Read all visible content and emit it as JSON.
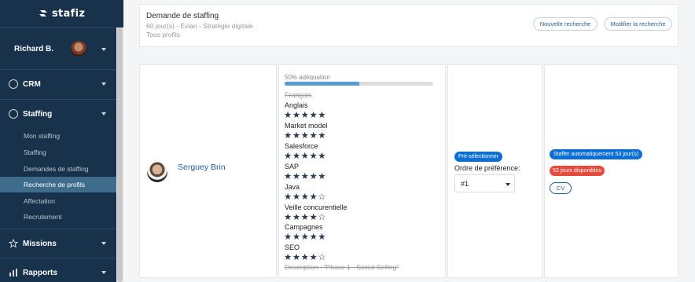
{
  "sidebar": {
    "logo_text": "stafiz",
    "user_name": "Richard B.",
    "sections": {
      "crm": "CRM",
      "staffing": "Staffing",
      "missions": "Missions",
      "rapports": "Rapports"
    },
    "staffing_items": [
      "Mon staffing",
      "Staffing",
      "Demandes de staffing",
      "Recherche de profils",
      "Affectation",
      "Recrutement"
    ],
    "active_item": "Recherche de profils"
  },
  "search": {
    "title": "Demande de staffing",
    "subtitle_1": "60 jour(s) - Évian - Stratégie digitale",
    "subtitle_2": "Tous profils",
    "new_search_label": "Nouvelle recherche",
    "edit_search_label": "Modifier la recherche"
  },
  "profile": {
    "name": "Serguey Brin",
    "match_label": "50% adéquation",
    "match_percent": 50,
    "skills_first_struck": "Français",
    "skills": [
      {
        "name": "Anglais",
        "stars": 5
      },
      {
        "name": "Market model",
        "stars": 5
      },
      {
        "name": "Salesforce",
        "stars": 5
      },
      {
        "name": "SAP",
        "stars": 5
      },
      {
        "name": "Java",
        "stars": 4
      },
      {
        "name": "Veille concurentielle",
        "stars": 4
      },
      {
        "name": "Campagnes",
        "stars": 5
      },
      {
        "name": "SEO",
        "stars": 4
      }
    ],
    "description_struck": "Description : \"Phase 1 - Social Selling\""
  },
  "preference": {
    "preselect_label": "Pré-sélectionner",
    "order_label": "Ordre de préférence:",
    "order_value": "#1"
  },
  "actions": {
    "auto_staff_label": "Staffer automatiquement 53 jour(s)",
    "available_label": "53 jours disponibles",
    "cv_label": "CV"
  },
  "colors": {
    "sidebar_bg": "#17324a",
    "active_item_bg": "#3f6b8c",
    "primary_blue": "#0b6fd6",
    "danger_red": "#e74a3b",
    "link_blue": "#1f5f99"
  }
}
